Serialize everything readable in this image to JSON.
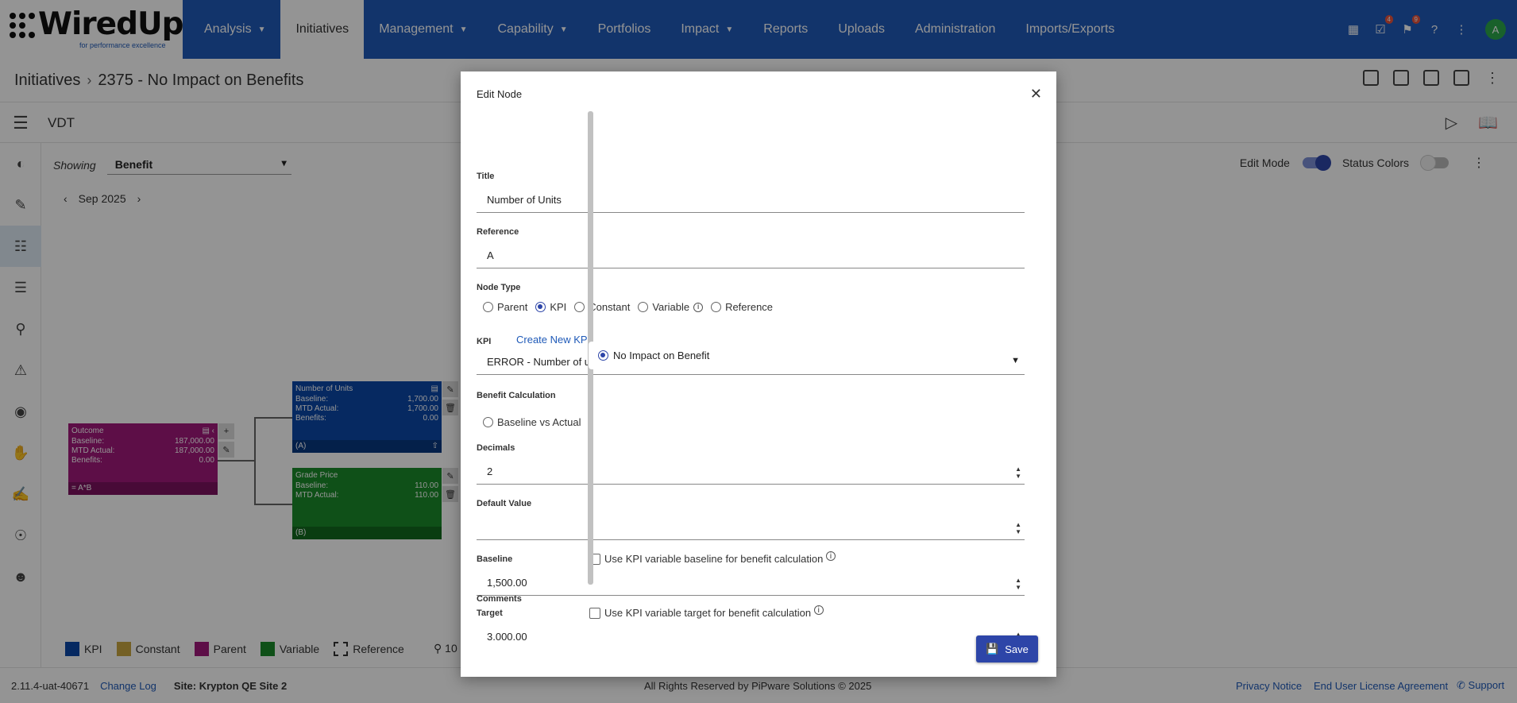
{
  "logo": {
    "text": "WiredUp",
    "tagline": "for performance excellence"
  },
  "nav": {
    "items": [
      {
        "label": "Analysis",
        "caret": true
      },
      {
        "label": "Initiatives",
        "caret": false,
        "active": true
      },
      {
        "label": "Management",
        "caret": true
      },
      {
        "label": "Capability",
        "caret": true
      },
      {
        "label": "Portfolios",
        "caret": false
      },
      {
        "label": "Impact",
        "caret": true
      },
      {
        "label": "Reports",
        "caret": false
      },
      {
        "label": "Uploads",
        "caret": false
      },
      {
        "label": "Administration",
        "caret": false
      },
      {
        "label": "Imports/Exports",
        "caret": false
      }
    ],
    "calendar_icon": "calendar-icon",
    "tasks_badge": "4",
    "bell_badge": "9",
    "avatar": "A"
  },
  "breadcrumb": {
    "root": "Initiatives",
    "current": "2375 - No Impact on Benefits"
  },
  "vdt": {
    "title": "VDT"
  },
  "canvas": {
    "showing_label": "Showing",
    "showing_value": "Benefit",
    "period": "Sep 2025",
    "edit_mode_label": "Edit Mode",
    "status_colors_label": "Status Colors",
    "edit_mode_on": true,
    "status_colors_on": false
  },
  "nodes": {
    "outcome": {
      "title": "Outcome",
      "baseline_label": "Baseline:",
      "baseline": "187,000.00",
      "mtd_label": "MTD Actual:",
      "mtd": "187,000.00",
      "benefits_label": "Benefits:",
      "benefits": "0.00",
      "formula": "= A*B",
      "color": "#a0197a"
    },
    "units": {
      "title": "Number of Units",
      "baseline_label": "Baseline:",
      "baseline": "1,700.00",
      "mtd_label": "MTD Actual:",
      "mtd": "1,700.00",
      "benefits_label": "Benefits:",
      "benefits": "0.00",
      "ref": "(A)",
      "color": "#0c48a8"
    },
    "grade": {
      "title": "Grade Price",
      "baseline_label": "Baseline:",
      "baseline": "110.00",
      "mtd_label": "MTD Actual:",
      "mtd": "110.00",
      "ref": "(B)",
      "color": "#1b8a2a"
    }
  },
  "legend": [
    {
      "label": "KPI",
      "color": "#0c48a8"
    },
    {
      "label": "Constant",
      "color": "#c9a640"
    },
    {
      "label": "Parent",
      "color": "#a0197a"
    },
    {
      "label": "Variable",
      "color": "#1b8a2a"
    },
    {
      "label": "Reference",
      "color": "#ffffff"
    }
  ],
  "zoom_text": "10",
  "footer": {
    "version": "2.11.4-uat-40671",
    "change_log": "Change Log",
    "site": "Site: Krypton QE Site 2",
    "rights": "All Rights Reserved by PiPware Solutions © 2025",
    "privacy": "Privacy Notice",
    "eula": "End User License Agreement",
    "support": "Support"
  },
  "modal": {
    "title": "Edit Node",
    "title_label": "Title",
    "title_value": "Number of Units",
    "reference_label": "Reference",
    "reference_value": "A",
    "node_type_label": "Node Type",
    "node_types": [
      "Parent",
      "KPI",
      "Constant",
      "Variable",
      "Reference"
    ],
    "node_type_selected": "KPI",
    "kpi_label": "KPI",
    "create_kpi": "Create New KPI",
    "kpi_value": "ERROR - Number of units",
    "benefit_calc_label": "Benefit Calculation",
    "benefit_options": [
      "Baseline vs Actual",
      "No Impact on Benefit"
    ],
    "benefit_selected": "No Impact on Benefit",
    "decimals_label": "Decimals",
    "decimals_value": "2",
    "default_value_label": "Default Value",
    "default_value": "",
    "baseline_label": "Baseline",
    "baseline_checkbox": "Use KPI variable baseline for benefit calculation",
    "baseline_value": "1,500.00",
    "target_label": "Target",
    "target_checkbox": "Use KPI variable target for benefit calculation",
    "target_value": "3,000.00",
    "comments_label": "Comments",
    "save": "Save"
  }
}
